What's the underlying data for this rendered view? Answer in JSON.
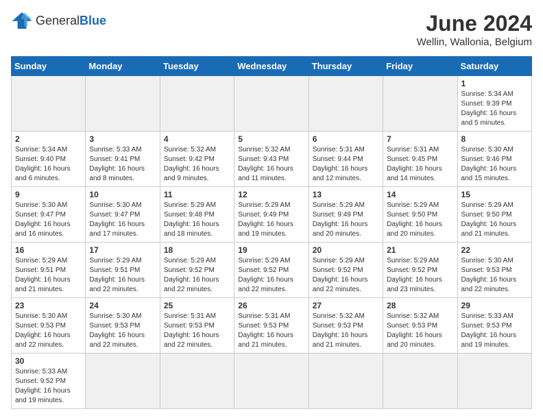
{
  "header": {
    "logo_text_regular": "General",
    "logo_text_bold": "Blue",
    "month_year": "June 2024",
    "location": "Wellin, Wallonia, Belgium"
  },
  "weekdays": [
    "Sunday",
    "Monday",
    "Tuesday",
    "Wednesday",
    "Thursday",
    "Friday",
    "Saturday"
  ],
  "weeks": [
    [
      {
        "day": "",
        "info": ""
      },
      {
        "day": "",
        "info": ""
      },
      {
        "day": "",
        "info": ""
      },
      {
        "day": "",
        "info": ""
      },
      {
        "day": "",
        "info": ""
      },
      {
        "day": "",
        "info": ""
      },
      {
        "day": "1",
        "info": "Sunrise: 5:34 AM\nSunset: 9:39 PM\nDaylight: 16 hours and 5 minutes."
      }
    ],
    [
      {
        "day": "2",
        "info": "Sunrise: 5:34 AM\nSunset: 9:40 PM\nDaylight: 16 hours and 6 minutes."
      },
      {
        "day": "3",
        "info": "Sunrise: 5:33 AM\nSunset: 9:41 PM\nDaylight: 16 hours and 8 minutes."
      },
      {
        "day": "4",
        "info": "Sunrise: 5:32 AM\nSunset: 9:42 PM\nDaylight: 16 hours and 9 minutes."
      },
      {
        "day": "5",
        "info": "Sunrise: 5:32 AM\nSunset: 9:43 PM\nDaylight: 16 hours and 11 minutes."
      },
      {
        "day": "6",
        "info": "Sunrise: 5:31 AM\nSunset: 9:44 PM\nDaylight: 16 hours and 12 minutes."
      },
      {
        "day": "7",
        "info": "Sunrise: 5:31 AM\nSunset: 9:45 PM\nDaylight: 16 hours and 14 minutes."
      },
      {
        "day": "8",
        "info": "Sunrise: 5:30 AM\nSunset: 9:46 PM\nDaylight: 16 hours and 15 minutes."
      }
    ],
    [
      {
        "day": "9",
        "info": "Sunrise: 5:30 AM\nSunset: 9:47 PM\nDaylight: 16 hours and 16 minutes."
      },
      {
        "day": "10",
        "info": "Sunrise: 5:30 AM\nSunset: 9:47 PM\nDaylight: 16 hours and 17 minutes."
      },
      {
        "day": "11",
        "info": "Sunrise: 5:29 AM\nSunset: 9:48 PM\nDaylight: 16 hours and 18 minutes."
      },
      {
        "day": "12",
        "info": "Sunrise: 5:29 AM\nSunset: 9:49 PM\nDaylight: 16 hours and 19 minutes."
      },
      {
        "day": "13",
        "info": "Sunrise: 5:29 AM\nSunset: 9:49 PM\nDaylight: 16 hours and 20 minutes."
      },
      {
        "day": "14",
        "info": "Sunrise: 5:29 AM\nSunset: 9:50 PM\nDaylight: 16 hours and 20 minutes."
      },
      {
        "day": "15",
        "info": "Sunrise: 5:29 AM\nSunset: 9:50 PM\nDaylight: 16 hours and 21 minutes."
      }
    ],
    [
      {
        "day": "16",
        "info": "Sunrise: 5:29 AM\nSunset: 9:51 PM\nDaylight: 16 hours and 21 minutes."
      },
      {
        "day": "17",
        "info": "Sunrise: 5:29 AM\nSunset: 9:51 PM\nDaylight: 16 hours and 22 minutes."
      },
      {
        "day": "18",
        "info": "Sunrise: 5:29 AM\nSunset: 9:52 PM\nDaylight: 16 hours and 22 minutes."
      },
      {
        "day": "19",
        "info": "Sunrise: 5:29 AM\nSunset: 9:52 PM\nDaylight: 16 hours and 22 minutes."
      },
      {
        "day": "20",
        "info": "Sunrise: 5:29 AM\nSunset: 9:52 PM\nDaylight: 16 hours and 22 minutes."
      },
      {
        "day": "21",
        "info": "Sunrise: 5:29 AM\nSunset: 9:52 PM\nDaylight: 16 hours and 23 minutes."
      },
      {
        "day": "22",
        "info": "Sunrise: 5:30 AM\nSunset: 9:53 PM\nDaylight: 16 hours and 22 minutes."
      }
    ],
    [
      {
        "day": "23",
        "info": "Sunrise: 5:30 AM\nSunset: 9:53 PM\nDaylight: 16 hours and 22 minutes."
      },
      {
        "day": "24",
        "info": "Sunrise: 5:30 AM\nSunset: 9:53 PM\nDaylight: 16 hours and 22 minutes."
      },
      {
        "day": "25",
        "info": "Sunrise: 5:31 AM\nSunset: 9:53 PM\nDaylight: 16 hours and 22 minutes."
      },
      {
        "day": "26",
        "info": "Sunrise: 5:31 AM\nSunset: 9:53 PM\nDaylight: 16 hours and 21 minutes."
      },
      {
        "day": "27",
        "info": "Sunrise: 5:32 AM\nSunset: 9:53 PM\nDaylight: 16 hours and 21 minutes."
      },
      {
        "day": "28",
        "info": "Sunrise: 5:32 AM\nSunset: 9:53 PM\nDaylight: 16 hours and 20 minutes."
      },
      {
        "day": "29",
        "info": "Sunrise: 5:33 AM\nSunset: 9:53 PM\nDaylight: 16 hours and 19 minutes."
      }
    ],
    [
      {
        "day": "30",
        "info": "Sunrise: 5:33 AM\nSunset: 9:52 PM\nDaylight: 16 hours and 19 minutes."
      },
      {
        "day": "",
        "info": ""
      },
      {
        "day": "",
        "info": ""
      },
      {
        "day": "",
        "info": ""
      },
      {
        "day": "",
        "info": ""
      },
      {
        "day": "",
        "info": ""
      },
      {
        "day": "",
        "info": ""
      }
    ]
  ]
}
